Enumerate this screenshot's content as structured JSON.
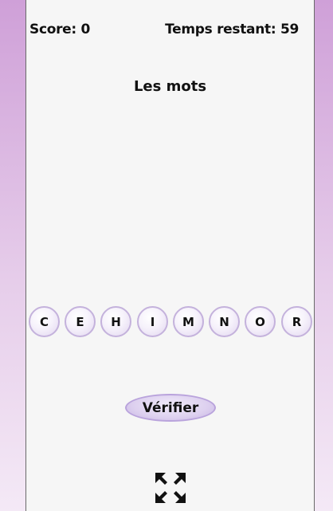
{
  "hud": {
    "score_label": "Score: 0",
    "timer_label": "Temps restant: 59"
  },
  "title": "Les mots",
  "letters": [
    "C",
    "E",
    "H",
    "I",
    "M",
    "N",
    "O",
    "R"
  ],
  "verify_label": "Vérifier",
  "icons": {
    "fullscreen": "fullscreen-expand-icon"
  },
  "colors": {
    "background_top": "#cfa0d8",
    "background_bottom": "#f4e9f6",
    "panel": "#f6f6f6",
    "letter_border": "#c4b2dc",
    "button_fill": "#ddd0ef"
  }
}
